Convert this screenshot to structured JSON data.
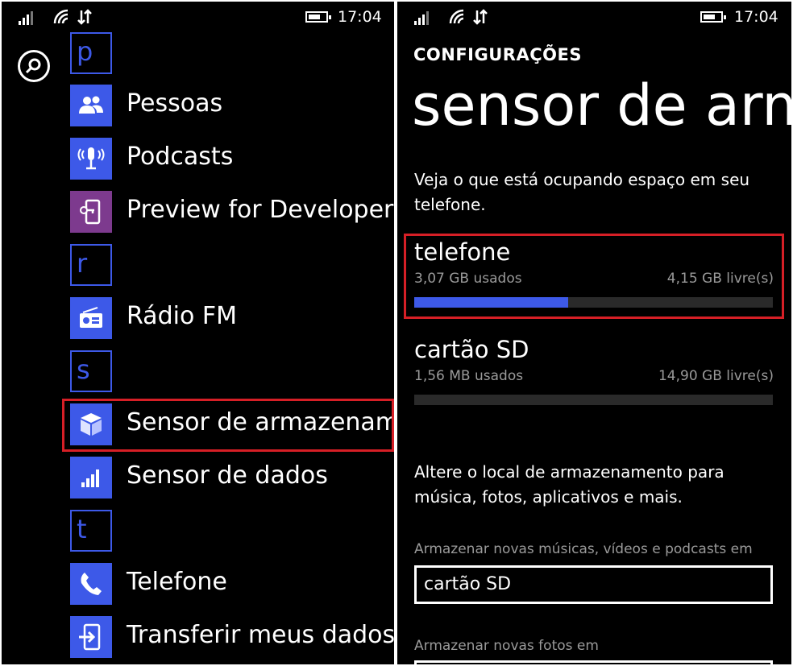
{
  "status": {
    "time": "17:04"
  },
  "left": {
    "letters": [
      "p",
      "r",
      "s",
      "t"
    ],
    "apps": [
      {
        "label": "Pessoas",
        "icon": "people-icon"
      },
      {
        "label": "Podcasts",
        "icon": "podcast-microphone-icon"
      },
      {
        "label": "Preview for Developers",
        "icon": "developer-phone-key-icon"
      },
      {
        "label": "Rádio FM",
        "icon": "radio-icon"
      },
      {
        "label": "Sensor de armazenamento",
        "icon": "storage-sense-icon"
      },
      {
        "label": "Sensor de dados",
        "icon": "data-sense-icon"
      },
      {
        "label": "Telefone",
        "icon": "phone-icon"
      },
      {
        "label": "Transferir meus dados",
        "icon": "transfer-data-icon"
      }
    ]
  },
  "right": {
    "header": "CONFIGURAÇÕES",
    "title": "sensor de armazenamento",
    "intro": "Veja o que está ocupando espaço em seu telefone.",
    "storage": [
      {
        "name": "telefone",
        "used": "3,07 GB usados",
        "free": "4,15 GB livre(s)",
        "fraction_used": 0.43
      },
      {
        "name": "cartão SD",
        "used": "1,56 MB usados",
        "free": "14,90 GB livre(s)",
        "fraction_used": 0.0
      }
    ],
    "change_text": "Altere o local de armazenamento para música, fotos, aplicativos e mais.",
    "settings": [
      {
        "label": "Armazenar novas músicas, vídeos e podcasts em",
        "value": "cartão SD"
      },
      {
        "label": "Armazenar novas fotos em",
        "value": ""
      }
    ]
  },
  "colors": {
    "accent": "#3d59e8",
    "highlight": "#d61f26",
    "background": "#000000",
    "secondary_text": "#9a9a9a"
  }
}
